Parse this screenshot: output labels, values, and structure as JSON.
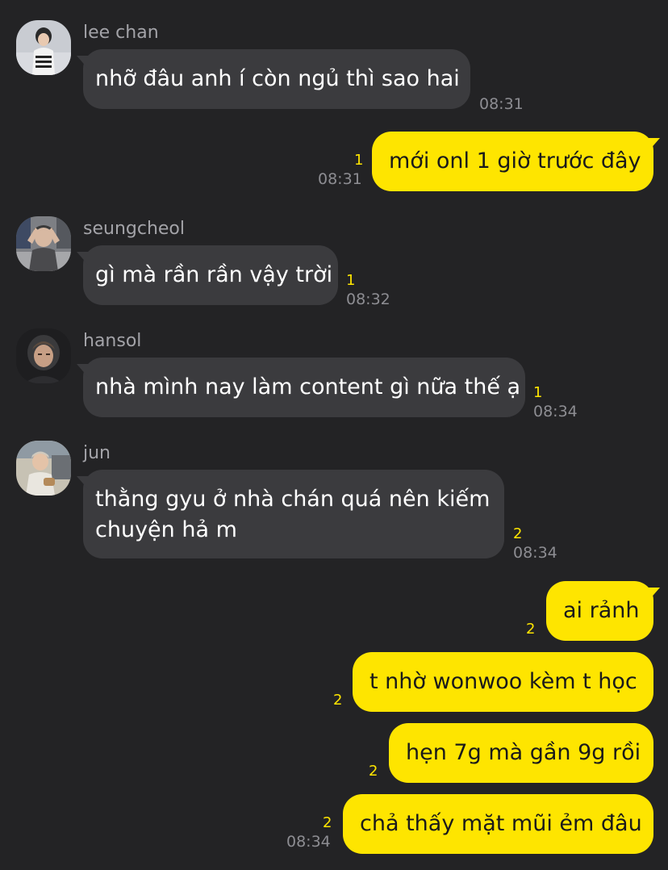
{
  "colors": {
    "background": "#232325",
    "incoming_bubble": "#3b3b3e",
    "outgoing_bubble": "#fee500",
    "unread_count": "#fee500",
    "timestamp": "#8d8d92",
    "sender_name": "#a3a3a8"
  },
  "messages": [
    {
      "sender": "lee chan",
      "avatar": "lee-chan-avatar-photo",
      "text": "nhỡ đâu anh í còn ngủ thì sao hai",
      "unread": "",
      "time": "08:31"
    },
    {
      "sender": "",
      "text": "mới onl 1 giờ trước đây",
      "unread": "1",
      "time": "08:31"
    },
    {
      "sender": "seungcheol",
      "avatar": "seungcheol-avatar-photo",
      "text": "gì mà rần rần vậy trời",
      "unread": "1",
      "time": "08:32"
    },
    {
      "sender": "hansol",
      "avatar": "hansol-avatar-photo",
      "text": "nhà mình nay làm content gì nữa thế ạ",
      "unread": "1",
      "time": "08:34"
    },
    {
      "sender": "jun",
      "avatar": "jun-avatar-photo",
      "text": "thằng gyu ở nhà chán quá nên kiếm chuyện hả m",
      "unread": "2",
      "time": "08:34"
    },
    {
      "sender": "",
      "text": "ai rảnh",
      "unread": "2",
      "time": ""
    },
    {
      "sender": "",
      "text": "t nhờ wonwoo kèm t học",
      "unread": "2",
      "time": ""
    },
    {
      "sender": "",
      "text": "hẹn 7g mà gần 9g rồi",
      "unread": "2",
      "time": ""
    },
    {
      "sender": "",
      "text": "chả thấy mặt mũi ẻm đâu",
      "unread": "2",
      "time": "08:34"
    }
  ]
}
